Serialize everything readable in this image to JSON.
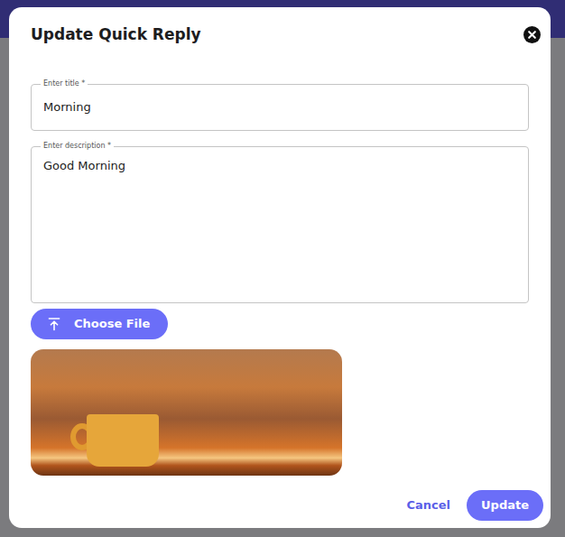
{
  "dialog": {
    "title": "Update Quick Reply"
  },
  "fields": [
    {
      "label": "Enter title *",
      "value": "Morning",
      "kind": "input"
    },
    {
      "label": "Enter description *",
      "value": "Good Morning",
      "kind": "textarea"
    }
  ],
  "file_button": "Choose File",
  "buttons": [
    {
      "label": "Cancel",
      "kind": "text"
    },
    {
      "label": "Update",
      "kind": "filled"
    }
  ]
}
